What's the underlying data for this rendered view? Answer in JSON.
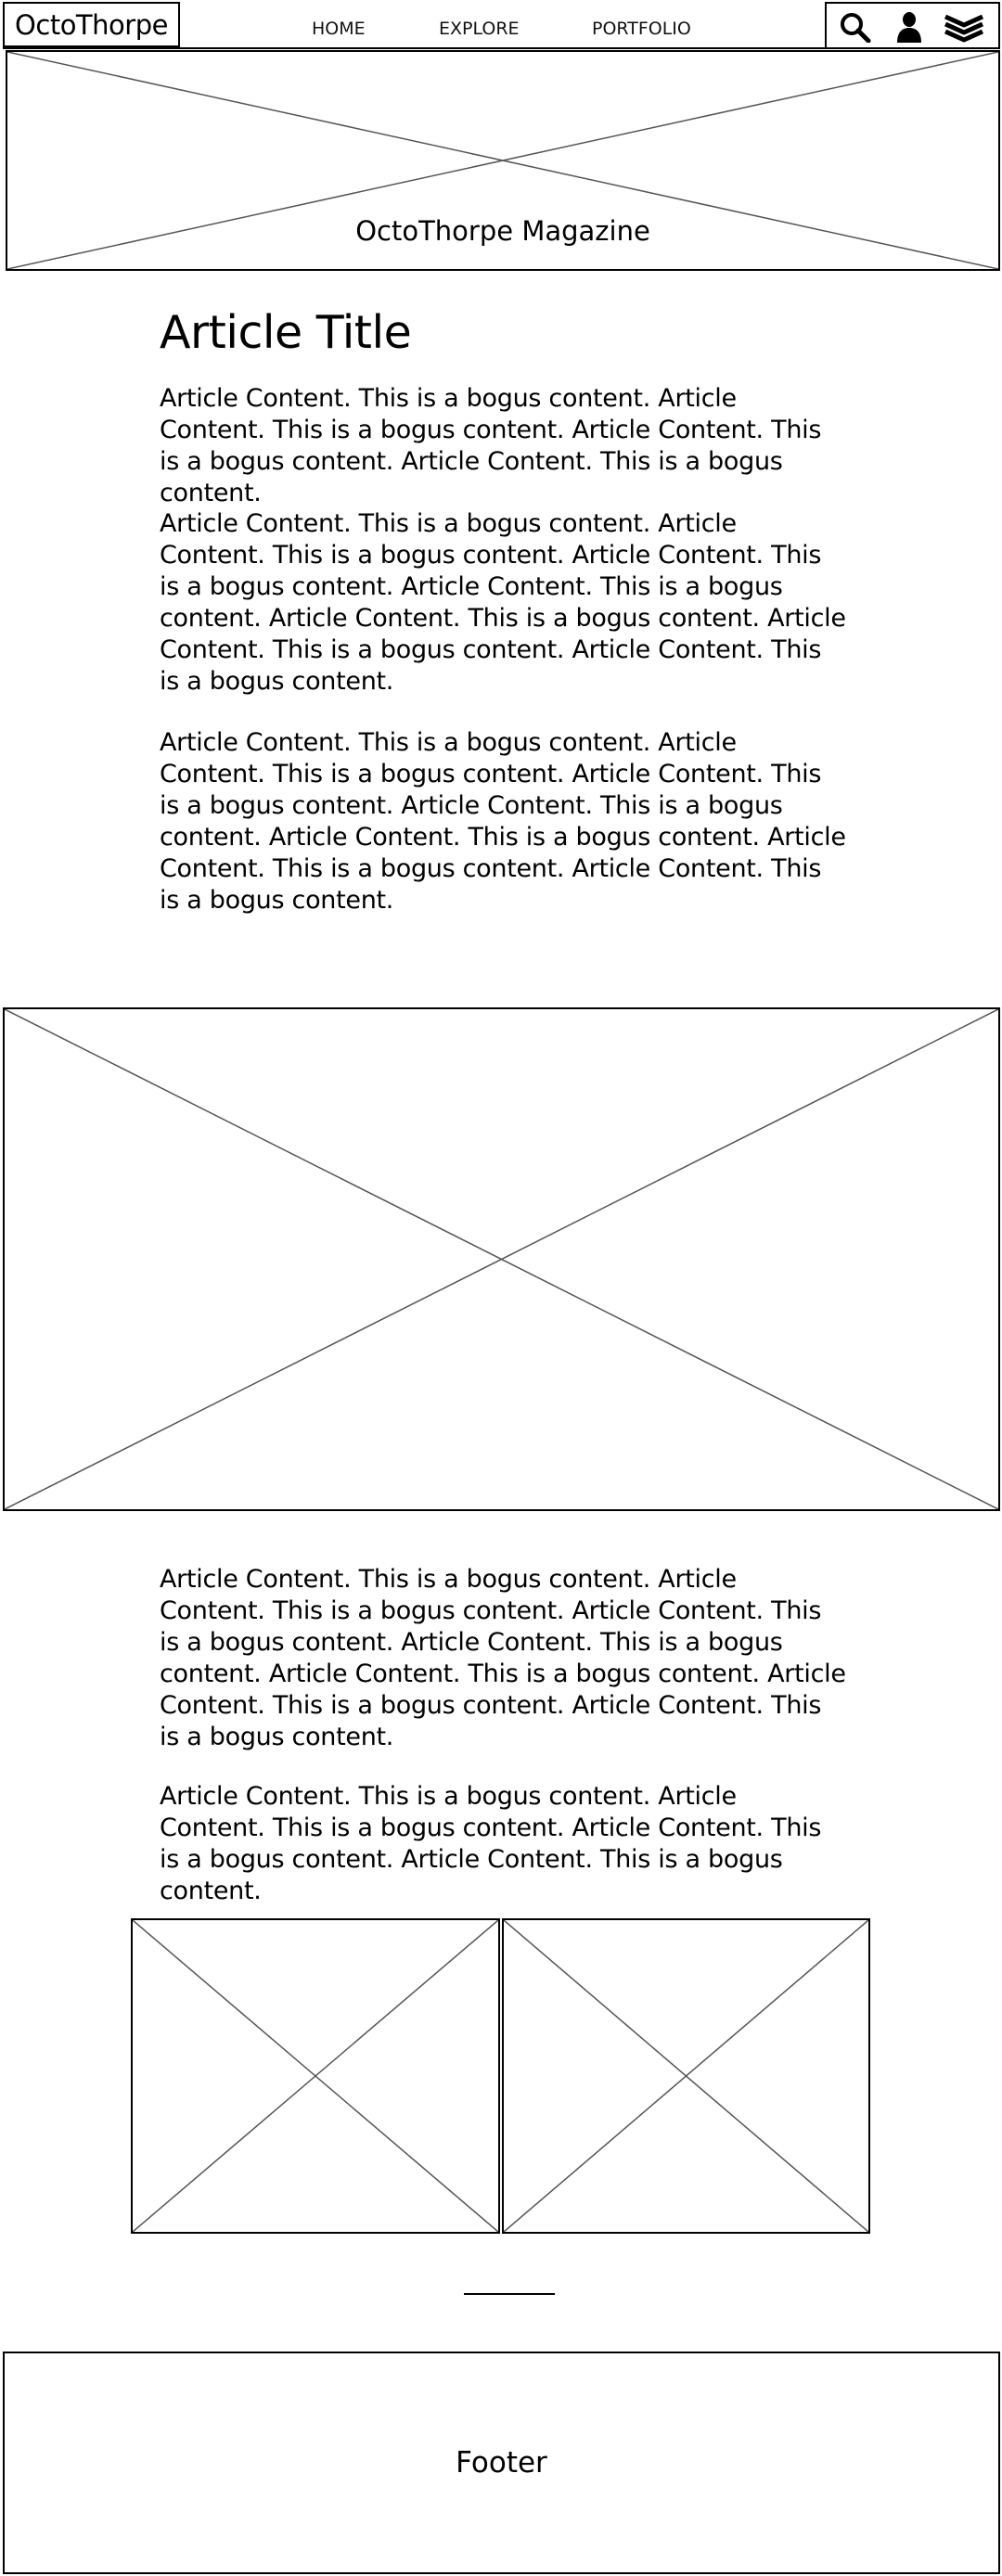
{
  "header": {
    "logo": "OctoThorpe",
    "nav": [
      {
        "label": "HOME"
      },
      {
        "label": "EXPLORE"
      },
      {
        "label": "PORTFOLIO"
      }
    ],
    "icons": [
      "search-icon",
      "user-icon",
      "menu-icon"
    ]
  },
  "hero": {
    "caption": "OctoThorpe Magazine"
  },
  "article": {
    "title": "Article Title",
    "paragraphs": [
      "Article Content. This is a bogus content. Article Content. This is a bogus content. Article Content. This is a bogus content. Article Content. This is a bogus content.",
      "Article Content. This is a bogus content. Article Content. This is a bogus content. Article Content. This is a bogus content. Article Content. This is a bogus content. Article Content. This is a bogus content. Article Content. This is a bogus content. Article Content. This is a bogus content.",
      "Article Content. This is a bogus content. Article Content. This is a bogus content. Article Content. This is a bogus content. Article Content. This is a bogus content. Article Content. This is a bogus content. Article Content. This is a bogus content. Article Content. This is a bogus content.",
      "Article Content. This is a bogus content. Article Content. This is a bogus content. Article Content. This is a bogus content. Article Content. This is a bogus content. Article Content. This is a bogus content. Article Content. This is a bogus content. Article Content. This is a bogus content.",
      "Article Content. This is a bogus content. Article Content. This is a bogus content. Article Content. This is a bogus content. Article Content. This is a bogus content."
    ]
  },
  "footer": {
    "label": "Footer"
  }
}
